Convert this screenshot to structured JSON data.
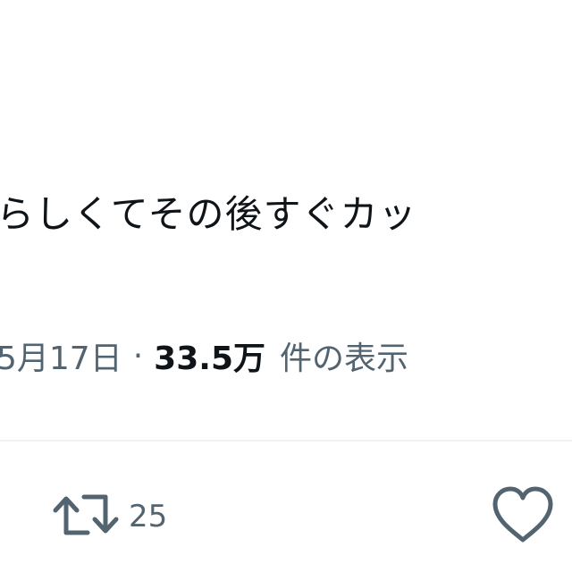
{
  "tweet": {
    "text": "らしくてその後すぐカッ"
  },
  "meta": {
    "date": "5月17日",
    "separator": "·",
    "views_count": "33.5万",
    "views_label": "件の表示"
  },
  "actions": {
    "retweet_count": "25"
  },
  "icons": {
    "retweet": "retweet-icon",
    "like": "heart-icon"
  },
  "colors": {
    "text_primary": "#0f1419",
    "text_secondary": "#536471",
    "divider": "#eff3f4"
  }
}
